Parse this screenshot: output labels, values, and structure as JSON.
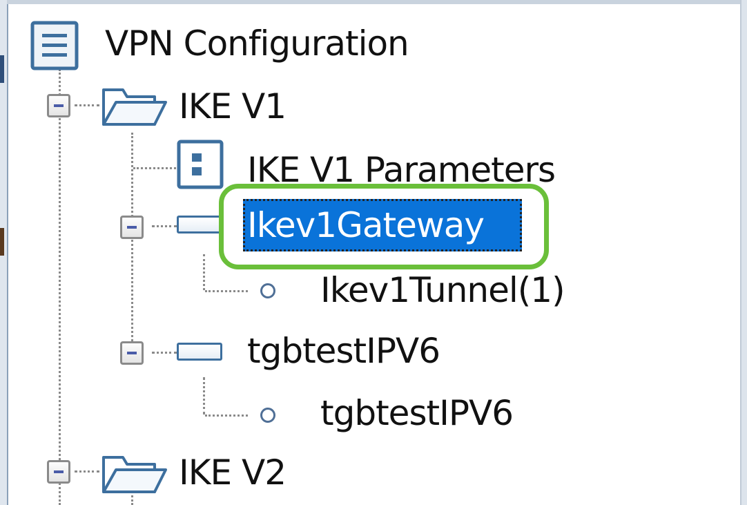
{
  "tree": {
    "root": {
      "label": "VPN Configuration",
      "icon": "config-list-icon"
    },
    "ike_v1": {
      "label": "IKE V1",
      "icon": "folder-open-icon",
      "parameters": {
        "label": "IKE V1 Parameters",
        "icon": "parameters-icon"
      },
      "gateways": [
        {
          "label": "Ikev1Gateway",
          "icon": "gateway-icon",
          "selected": true,
          "tunnels": [
            {
              "label": "Ikev1Tunnel(1)",
              "icon": "tunnel-dot-icon"
            }
          ]
        },
        {
          "label": "tgbtestIPV6",
          "icon": "gateway-icon",
          "selected": false,
          "tunnels": [
            {
              "label": "tgbtestIPV6",
              "icon": "tunnel-dot-icon"
            }
          ]
        }
      ]
    },
    "ike_v2": {
      "label": "IKE V2",
      "icon": "folder-open-icon"
    }
  },
  "colors": {
    "selection": "#0a73d9",
    "highlight_ring": "#6abf3a",
    "icon_blue": "#3d6f9e",
    "tree_lines": "#8a8a8a"
  }
}
